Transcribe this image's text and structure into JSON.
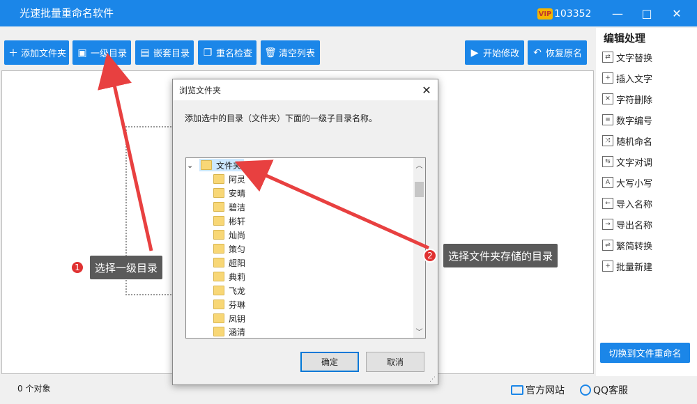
{
  "app": {
    "title": "光速批量重命名软件",
    "user_id": "103352",
    "vip_label": "VIP"
  },
  "window": {
    "minimize": "—",
    "maximize": "□",
    "close": "✕"
  },
  "toolbar": {
    "add_folder": "添加文件夹",
    "level1_dir": "一级目录",
    "nested_dir": "嵌套目录",
    "dup_check": "重名检查",
    "clear_list": "清空列表",
    "start": "开始修改",
    "restore": "恢复原名"
  },
  "panel": {
    "title": "编辑处理",
    "items": [
      "文字替换",
      "插入文字",
      "字符删除",
      "数字编号",
      "随机命名",
      "文字对调",
      "大写小写",
      "导入名称",
      "导出名称",
      "繁简转换",
      "批量新建"
    ],
    "switch_button": "切换到文件重命名"
  },
  "status": {
    "count": "0 个对象",
    "site": "官方网站",
    "qq": "QQ客服"
  },
  "dialog": {
    "title": "浏览文件夹",
    "description": "添加选中的目录（文件夹）下面的一级子目录名称。",
    "root": "文件夹",
    "children": [
      "阿灵",
      "安晴",
      "碧洁",
      "彬轩",
      "灿尚",
      "策匀",
      "超阳",
      "典莉",
      "飞龙",
      "芬琳",
      "凤钥",
      "涵清"
    ],
    "ok": "确定",
    "cancel": "取消"
  },
  "callouts": [
    {
      "num": "1",
      "text": "选择一级目录"
    },
    {
      "num": "2",
      "text": "选择文件夹存储的目录"
    }
  ],
  "colors": {
    "accent": "#1b86e8",
    "callout_bg": "#5a5a5a",
    "badge": "#e03131",
    "arrow": "#e84040"
  }
}
